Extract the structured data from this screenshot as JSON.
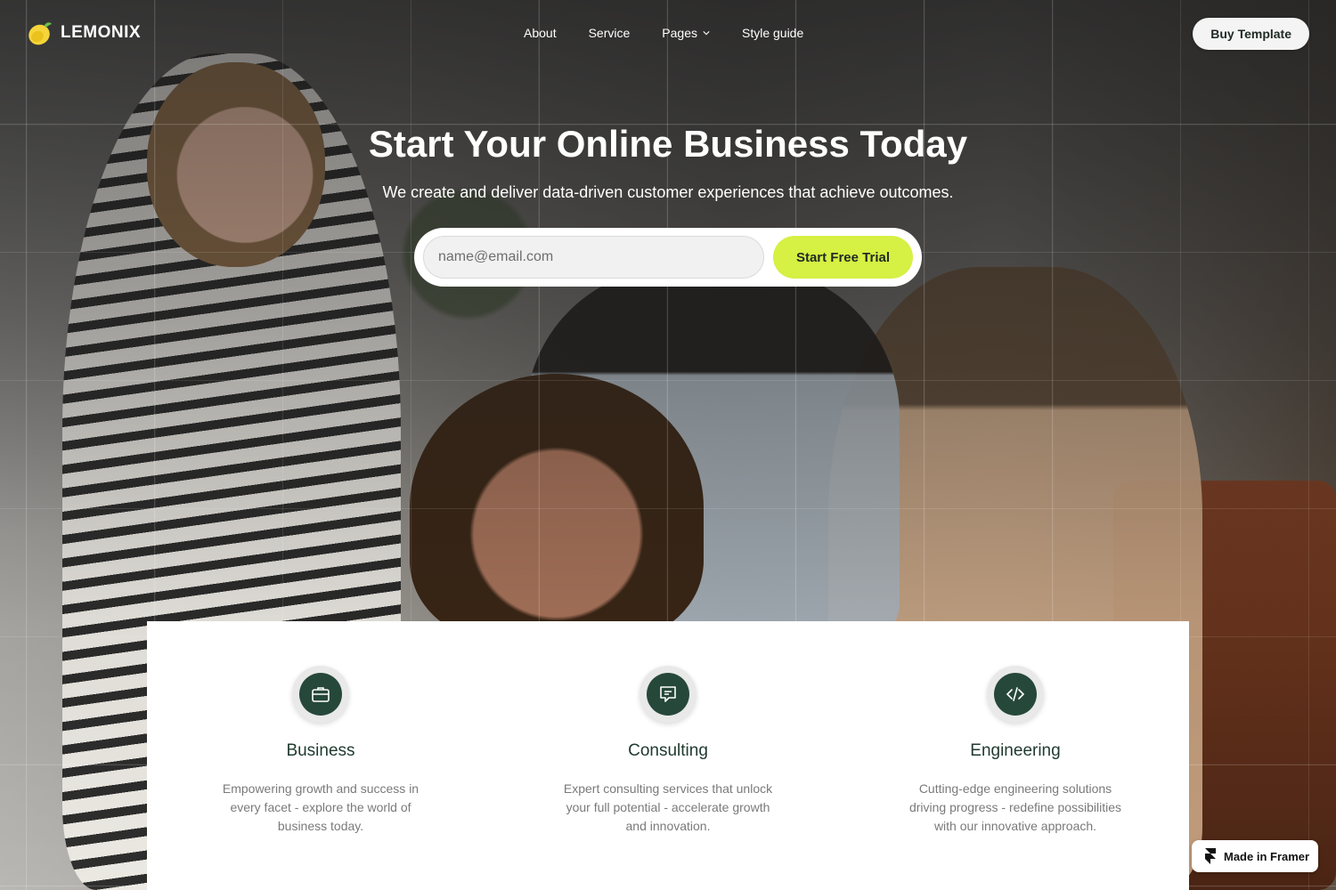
{
  "brand": {
    "name": "LEMONIX",
    "logo_icon": "lemon-icon",
    "accent": "#d6f043",
    "dark_green": "#26483a"
  },
  "nav": {
    "links": [
      {
        "label": "About"
      },
      {
        "label": "Service"
      },
      {
        "label": "Pages",
        "icon": "chevron-down-icon"
      },
      {
        "label": "Style guide"
      }
    ],
    "cta_label": "Buy Template"
  },
  "hero": {
    "title": "Start Your Online Business Today",
    "subtitle": "We create and deliver data-driven customer experiences that achieve outcomes.",
    "email_placeholder": "name@email.com",
    "email_value": "",
    "cta_label": "Start Free Trial"
  },
  "services": [
    {
      "icon": "briefcase-icon",
      "title": "Business",
      "description": "Empowering growth and success in every facet - explore the world of business today."
    },
    {
      "icon": "message-icon",
      "title": "Consulting",
      "description": "Expert consulting services that unlock your full potential - accelerate growth and innovation."
    },
    {
      "icon": "code-icon",
      "title": "Engineering",
      "description": "Cutting-edge engineering solutions driving progress - redefine possibilities with our innovative approach."
    }
  ],
  "badge": {
    "label": "Made in Framer",
    "icon": "framer-icon"
  }
}
